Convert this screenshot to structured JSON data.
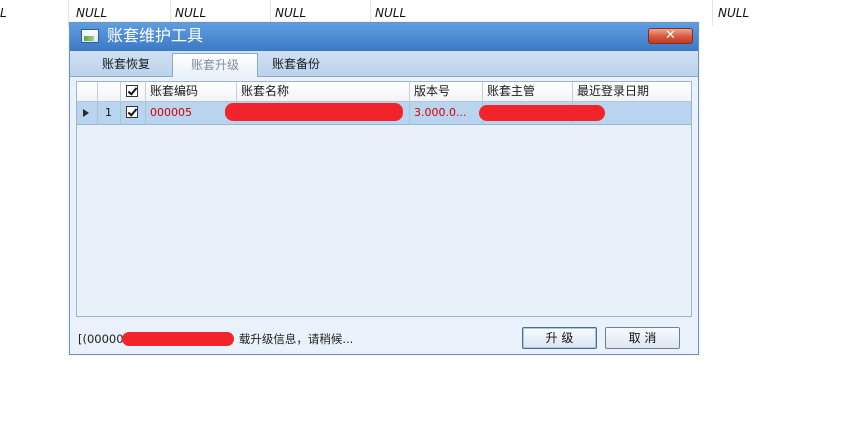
{
  "background_sheet": {
    "cells": [
      "L",
      "NULL",
      "NULL",
      "NULL",
      "NULL",
      "NULL"
    ]
  },
  "window": {
    "title": "账套维护工具",
    "close_glyph": "✕"
  },
  "tabs": [
    {
      "label": "账套恢复",
      "active": false
    },
    {
      "label": "账套升级",
      "active": true
    },
    {
      "label": "账套备份",
      "active": false
    }
  ],
  "grid": {
    "columns": [
      "",
      "",
      "账套编码",
      "账套名称",
      "版本号",
      "账套主管",
      "最近登录日期"
    ],
    "rows": [
      {
        "row_number": "1",
        "checked": true,
        "code": "000005",
        "name": "",
        "version": "3.000.0...",
        "manager": "",
        "last_login": ""
      }
    ]
  },
  "status": {
    "prefix": "[(000000",
    "suffix": "载升级信息，请稍候..."
  },
  "buttons": {
    "upgrade_label": "升 级",
    "cancel_label": "取 消"
  },
  "colors": {
    "title_bar": "#3b79c6",
    "close_button": "#d6573e",
    "selected_row": "#b9d4ef",
    "row_text": "#d40000",
    "redaction": "#f0242a"
  },
  "icons": {
    "app": "window-icon",
    "close": "close-icon",
    "row_indicator": "row-pointer-icon",
    "checkbox": "checkbox-checked-icon"
  }
}
